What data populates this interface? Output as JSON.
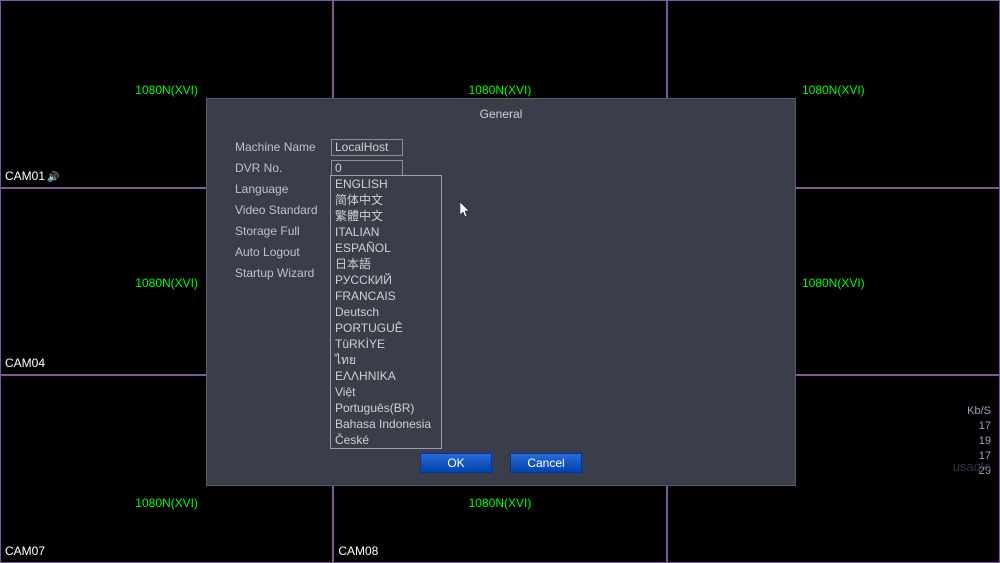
{
  "grid": {
    "res_label": "1080N(XVI)",
    "cams": {
      "c1": "CAM01",
      "c4": "CAM04",
      "c7": "CAM07",
      "c8": "CAM08"
    }
  },
  "stats": {
    "header": "Kb/S",
    "rows": [
      "17",
      "19",
      "17",
      "29"
    ]
  },
  "watermark": "usaqlo",
  "dialog": {
    "title": "General",
    "labels": {
      "machine_name": "Machine Name",
      "dvr_no": "DVR No.",
      "language": "Language",
      "video_standard": "Video Standard",
      "storage_full": "Storage Full",
      "auto_logout": "Auto Logout",
      "startup_wizard": "Startup Wizard"
    },
    "values": {
      "machine_name": "LocalHost",
      "dvr_no": "0",
      "language": "ENGLISH"
    },
    "buttons": {
      "ok": "OK",
      "cancel": "Cancel"
    }
  },
  "languages": [
    "ENGLISH",
    "简体中文",
    "繁體中文",
    "ITALIAN",
    "ESPAÑOL",
    "日本語",
    "РУССКИЙ",
    "FRANCAIS",
    "Deutsch",
    "PORTUGUÊ",
    "TüRKİYE",
    "ไทย",
    "ΕΛΛΗΝΙΚΑ",
    "Việt",
    "Português(BR)",
    "Bahasa Indonesia",
    "České"
  ]
}
